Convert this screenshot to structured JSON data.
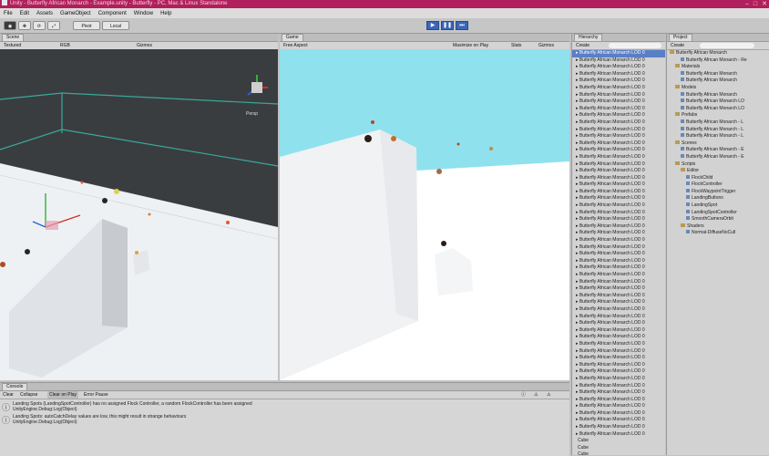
{
  "window": {
    "title": "Unity - Butterfly African Monarch - Example.unity - Butterfly - PC, Mac & Linux Standalone",
    "controls": [
      "–",
      "□",
      "✕"
    ]
  },
  "menu": [
    "File",
    "Edit",
    "Assets",
    "GameObject",
    "Component",
    "Window",
    "Help"
  ],
  "toolbar": {
    "pivot_label": "Pivot",
    "local_label": "Local",
    "play_icon": "play-icon",
    "pause_icon": "pause-icon",
    "step_icon": "step-icon"
  },
  "scene": {
    "tab_label": "Scene",
    "shading_mode": "Textured",
    "render_mode": "RGB",
    "gizmos_label": "Gizmos",
    "persp_label": "Persp"
  },
  "game": {
    "tab_label": "Game",
    "aspect_label": "Free Aspect",
    "maximize_label": "Maximize on Play",
    "stats_label": "Stats",
    "gizmos_label": "Gizmos",
    "sky_color": "#8fe1ee"
  },
  "hierarchy": {
    "tab_label": "Hierarchy",
    "create_label": "Create",
    "items": [
      "Butterfly African Monarch LOD 0",
      "Butterfly African Monarch LOD 0",
      "Butterfly African Monarch LOD 0",
      "Butterfly African Monarch LOD 0",
      "Butterfly African Monarch LOD 0",
      "Butterfly African Monarch LOD 0",
      "Butterfly African Monarch LOD 0",
      "Butterfly African Monarch LOD 0",
      "Butterfly African Monarch LOD 0",
      "Butterfly African Monarch LOD 0",
      "Butterfly African Monarch LOD 0",
      "Butterfly African Monarch LOD 0",
      "Butterfly African Monarch LOD 0",
      "Butterfly African Monarch LOD 0",
      "Butterfly African Monarch LOD 0",
      "Butterfly African Monarch LOD 0",
      "Butterfly African Monarch LOD 0",
      "Butterfly African Monarch LOD 0",
      "Butterfly African Monarch LOD 0",
      "Butterfly African Monarch LOD 0",
      "Butterfly African Monarch LOD 0",
      "Butterfly African Monarch LOD 0",
      "Butterfly African Monarch LOD 0",
      "Butterfly African Monarch LOD 0",
      "Butterfly African Monarch LOD 0",
      "Butterfly African Monarch LOD 0",
      "Butterfly African Monarch LOD 0",
      "Butterfly African Monarch LOD 0",
      "Butterfly African Monarch LOD 0",
      "Butterfly African Monarch LOD 0",
      "Butterfly African Monarch LOD 0",
      "Butterfly African Monarch LOD 0",
      "Butterfly African Monarch LOD 0",
      "Butterfly African Monarch LOD 0",
      "Butterfly African Monarch LOD 0",
      "Butterfly African Monarch LOD 0",
      "Butterfly African Monarch LOD 0",
      "Butterfly African Monarch LOD 0",
      "Butterfly African Monarch LOD 0",
      "Butterfly African Monarch LOD 0",
      "Butterfly African Monarch LOD 0",
      "Butterfly African Monarch LOD 0",
      "Butterfly African Monarch LOD 0",
      "Butterfly African Monarch LOD 0",
      "Butterfly African Monarch LOD 0",
      "Butterfly African Monarch LOD 0",
      "Butterfly African Monarch LOD 0",
      "Butterfly African Monarch LOD 0",
      "Butterfly African Monarch LOD 0",
      "Butterfly African Monarch LOD 0",
      "Butterfly African Monarch LOD 0",
      "Butterfly African Monarch LOD 0",
      "Butterfly African Monarch LOD 0",
      "Butterfly African Monarch LOD 0",
      "Butterfly African Monarch LOD 0",
      "Butterfly African Monarch LOD 0",
      "Cube",
      "Cube",
      "Cube"
    ]
  },
  "project": {
    "tab_label": "Project",
    "create_label": "Create",
    "items": [
      {
        "label": "Butterfly African Monarch",
        "kind": "folder"
      },
      {
        "label": "Butterfly African Monarch - Re",
        "kind": "asset"
      },
      {
        "label": "Materials",
        "kind": "folder"
      },
      {
        "label": "Butterfly African Monarch",
        "kind": "asset"
      },
      {
        "label": "Butterfly African Monarch",
        "kind": "asset"
      },
      {
        "label": "Models",
        "kind": "folder"
      },
      {
        "label": "Butterfly African Monarch",
        "kind": "asset"
      },
      {
        "label": "Butterfly African Monarch LO",
        "kind": "asset"
      },
      {
        "label": "Butterfly African Monarch LO",
        "kind": "asset"
      },
      {
        "label": "Prefabs",
        "kind": "folder"
      },
      {
        "label": "Butterfly African Monarch - L",
        "kind": "asset"
      },
      {
        "label": "Butterfly African Monarch - L",
        "kind": "asset"
      },
      {
        "label": "Butterfly African Monarch - L",
        "kind": "asset"
      },
      {
        "label": "Scenes",
        "kind": "folder"
      },
      {
        "label": "Butterfly African Monarch - E",
        "kind": "asset"
      },
      {
        "label": "Butterfly African Monarch - E",
        "kind": "asset"
      },
      {
        "label": "Scripts",
        "kind": "folder"
      },
      {
        "label": "Editor",
        "kind": "folder"
      },
      {
        "label": "FlockChild",
        "kind": "asset"
      },
      {
        "label": "FlockController",
        "kind": "asset"
      },
      {
        "label": "FlockWaypointTrigger",
        "kind": "asset"
      },
      {
        "label": "LandingButtons",
        "kind": "asset"
      },
      {
        "label": "LandingSpot",
        "kind": "asset"
      },
      {
        "label": "LandingSpotController",
        "kind": "asset"
      },
      {
        "label": "SmoothCameraOrbit",
        "kind": "asset"
      },
      {
        "label": "Shaders",
        "kind": "folder"
      },
      {
        "label": "Normal-DiffuseNoCull",
        "kind": "asset"
      }
    ]
  },
  "console": {
    "tab_label": "Console",
    "buttons": [
      "Clear",
      "Collapse",
      "Clear on Play",
      "Error Pause"
    ],
    "messages": [
      {
        "line1": "Landing Spots (LandingSpotController) has no assigned Flock Controller, a random FlockController has been assigned",
        "line2": "UnityEngine.Debug:Log(Object)"
      },
      {
        "line1": "Landing Spots: autoCatchDelay values are low, this might result in strange behaviours",
        "line2": "UnityEngine.Debug:Log(Object)"
      }
    ]
  }
}
